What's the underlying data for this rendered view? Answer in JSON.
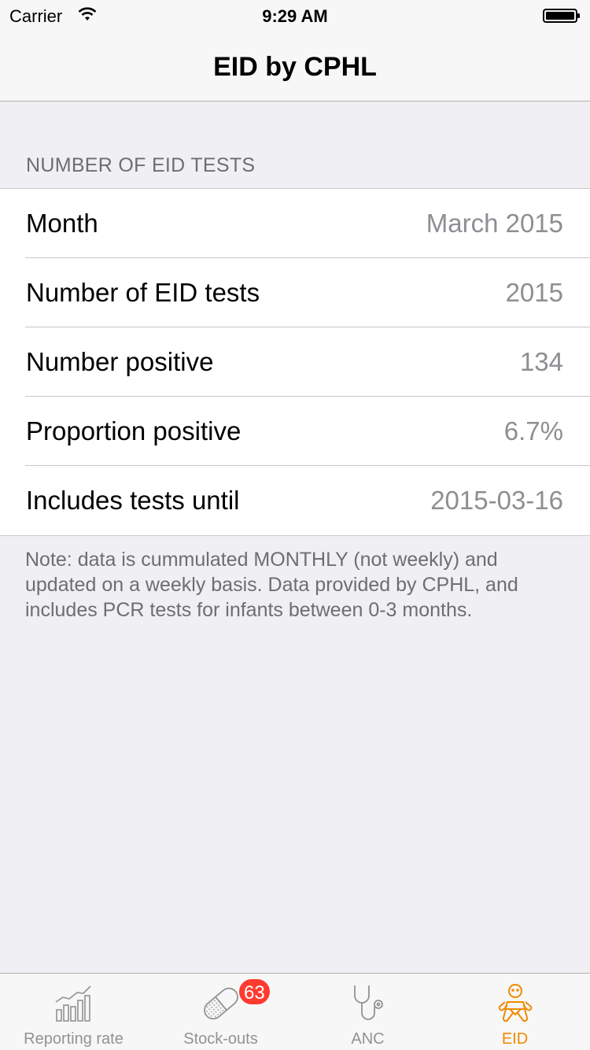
{
  "status_bar": {
    "carrier": "Carrier",
    "time": "9:29 AM"
  },
  "nav": {
    "title": "EID by CPHL"
  },
  "section": {
    "header": "NUMBER OF EID TESTS",
    "rows": [
      {
        "label": "Month",
        "value": "March 2015"
      },
      {
        "label": "Number of EID tests",
        "value": "2015"
      },
      {
        "label": "Number positive",
        "value": "134"
      },
      {
        "label": "Proportion positive",
        "value": "6.7%"
      },
      {
        "label": "Includes tests until",
        "value": "2015-03-16"
      }
    ],
    "note": "Note: data is cummulated MONTHLY (not weekly) and updated on a weekly basis. Data provided by CPHL, and includes PCR tests for infants between 0-3 months."
  },
  "tabs": [
    {
      "label": "Reporting rate",
      "icon": "bar-chart-icon",
      "active": false
    },
    {
      "label": "Stock-outs",
      "icon": "pill-icon",
      "active": false,
      "badge": "63"
    },
    {
      "label": "ANC",
      "icon": "stethoscope-icon",
      "active": false
    },
    {
      "label": "EID",
      "icon": "baby-icon",
      "active": true
    }
  ],
  "colors": {
    "accent": "#f08a00",
    "badge": "#ff3b30",
    "inactive_tab": "#929292",
    "background": "#efeff4"
  }
}
